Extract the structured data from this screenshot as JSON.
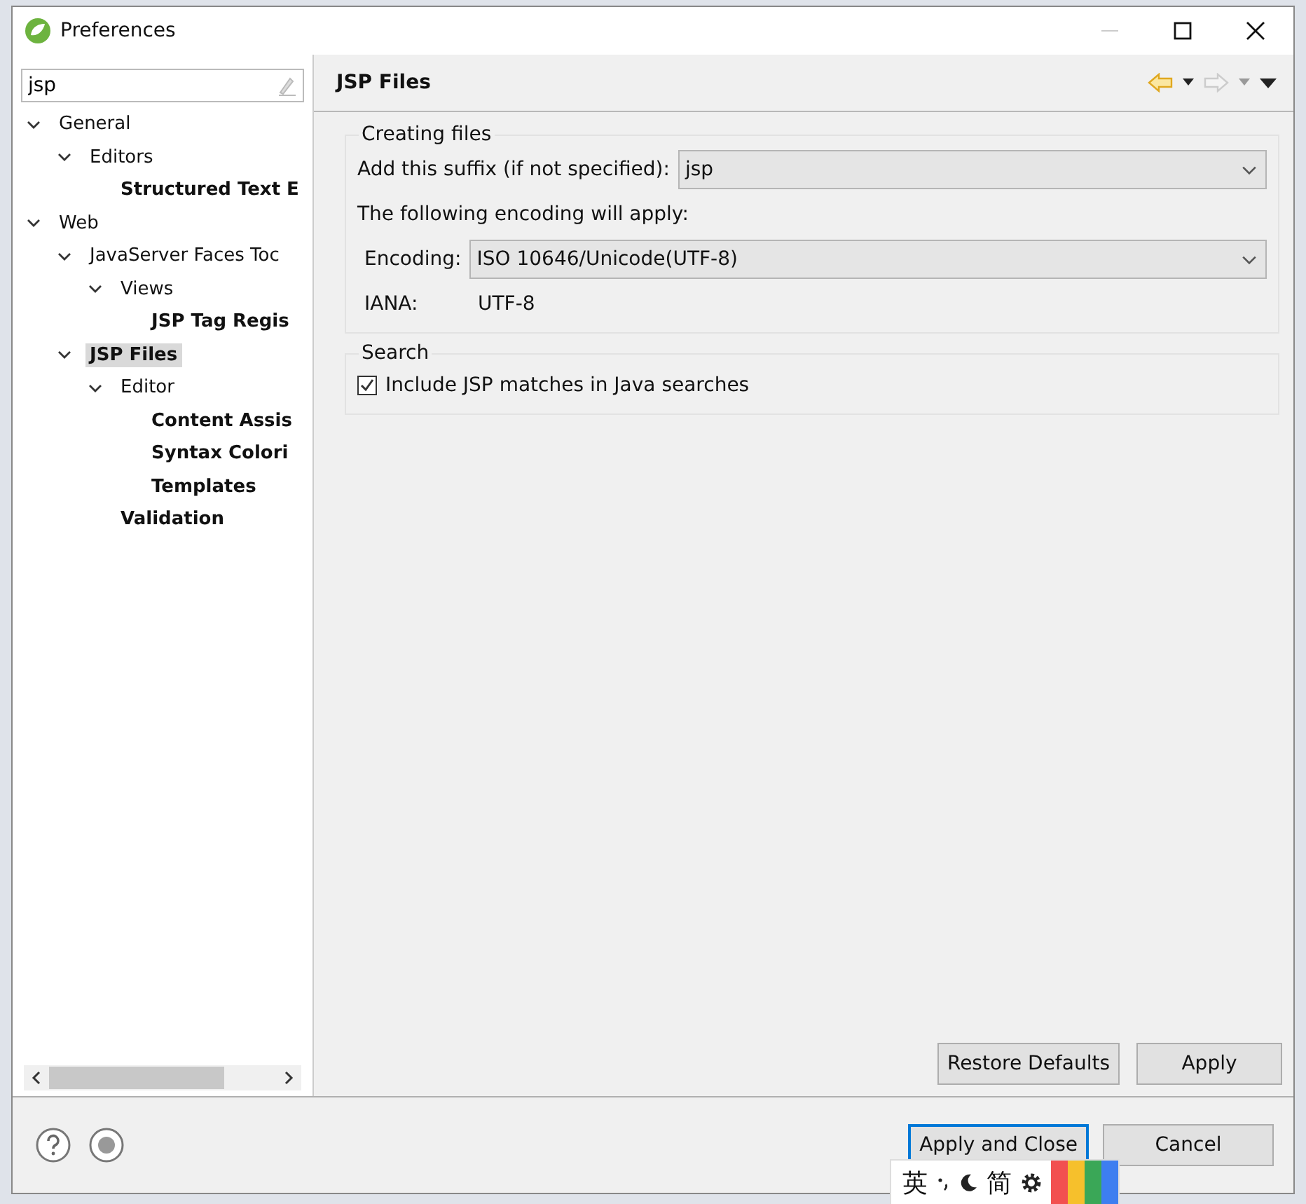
{
  "window": {
    "title": "Preferences"
  },
  "filter": {
    "value": "jsp"
  },
  "tree": [
    {
      "label": "General",
      "expanded": true,
      "matched": false,
      "selected": false,
      "children": [
        {
          "label": "Editors",
          "expanded": true,
          "matched": false,
          "selected": false,
          "children": [
            {
              "label": "Structured Text E",
              "matched": true,
              "selected": false
            }
          ]
        }
      ]
    },
    {
      "label": "Web",
      "expanded": true,
      "matched": false,
      "selected": false,
      "children": [
        {
          "label": "JavaServer Faces Toc",
          "expanded": true,
          "matched": false,
          "selected": false,
          "children": [
            {
              "label": "Views",
              "expanded": true,
              "matched": false,
              "selected": false,
              "children": [
                {
                  "label": "JSP Tag Regis",
                  "matched": true,
                  "selected": false
                }
              ]
            }
          ]
        },
        {
          "label": "JSP Files",
          "expanded": true,
          "matched": true,
          "selected": true,
          "children": [
            {
              "label": "Editor",
              "expanded": true,
              "matched": false,
              "selected": false,
              "children": [
                {
                  "label": "Content Assis",
                  "matched": true,
                  "selected": false
                },
                {
                  "label": "Syntax Colori",
                  "matched": true,
                  "selected": false
                },
                {
                  "label": "Templates",
                  "matched": true,
                  "selected": false
                }
              ]
            },
            {
              "label": "Validation",
              "matched": true,
              "selected": false
            }
          ]
        }
      ]
    }
  ],
  "page": {
    "title": "JSP Files",
    "groups": [
      {
        "title": "Creating files",
        "rows": [
          {
            "kind": "combo",
            "label": "Add this suffix (if not specified):",
            "value": "jsp"
          },
          {
            "kind": "text",
            "label": "The following encoding will apply:"
          },
          {
            "kind": "combo",
            "label": "Encoding:",
            "value": "ISO 10646/Unicode(UTF-8)",
            "indent": true
          },
          {
            "kind": "pair",
            "label": "IANA:",
            "value": "UTF-8"
          }
        ]
      },
      {
        "title": "Search",
        "rows": [
          {
            "kind": "checkbox",
            "label": "Include JSP matches in Java searches",
            "checked": true
          }
        ]
      }
    ],
    "buttons": [
      "Restore Defaults",
      "Apply"
    ]
  },
  "footer": {
    "buttons": [
      {
        "label": "Apply and Close",
        "default": true
      },
      {
        "label": "Cancel",
        "default": false
      }
    ]
  },
  "ime": {
    "mode": "英",
    "script": "简"
  }
}
